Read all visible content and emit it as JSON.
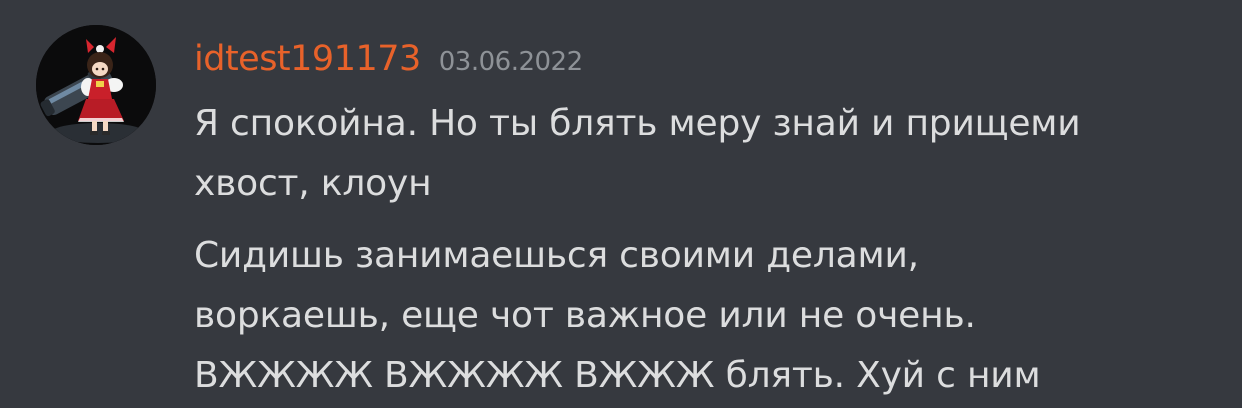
{
  "colors": {
    "background": "#36393f",
    "username": "#e8622a",
    "timestamp": "#8e9297",
    "message_text": "#dcddde"
  },
  "message": {
    "avatar_icon": "user-avatar-icon",
    "username": "idtest191173",
    "timestamp": "03.06.2022",
    "paragraphs": [
      {
        "lines": [
          "Я спокойна. Но ты блять меру знай и прищеми",
          "хвост, клоун"
        ]
      },
      {
        "lines": [
          "Сидишь занимаешься своими делами,",
          "воркаешь, еще чот важное или не очень.",
          "ВЖЖЖЖ ВЖЖЖЖ ВЖЖЖ блять. Хуй с ним"
        ]
      }
    ]
  }
}
